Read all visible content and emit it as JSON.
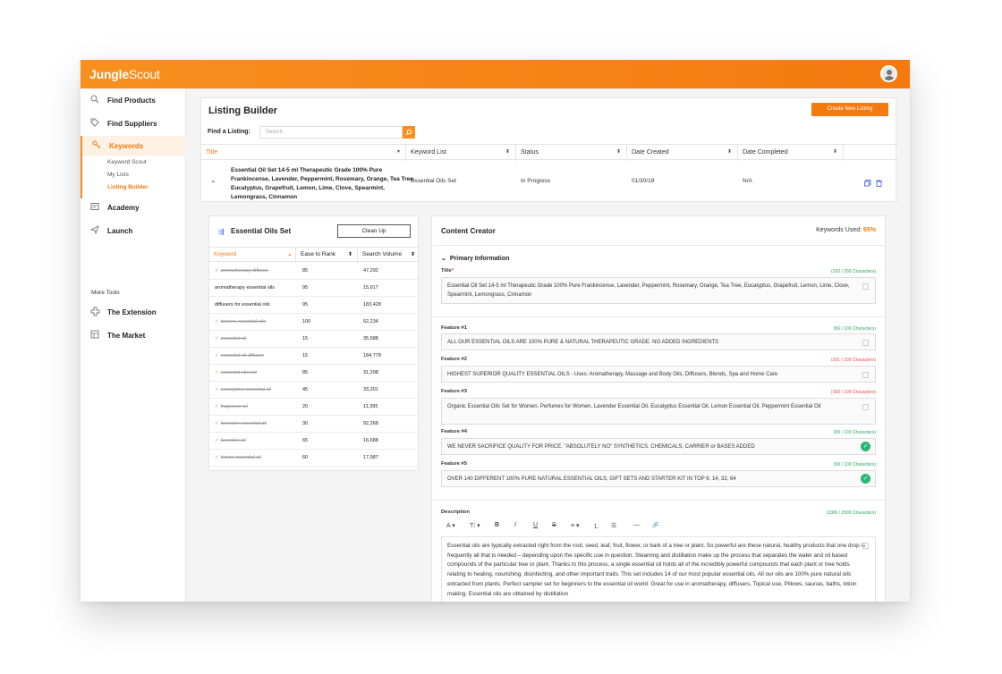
{
  "app": {
    "logo_bold": "Jungle",
    "logo_light": "Scout"
  },
  "sidebar": {
    "items": [
      {
        "label": "Find Products",
        "icon": "search-icon"
      },
      {
        "label": "Find Suppliers",
        "icon": "tag-icon"
      },
      {
        "label": "Keywords",
        "icon": "key-icon",
        "active": true
      },
      {
        "label": "Academy",
        "icon": "academy-icon"
      },
      {
        "label": "Launch",
        "icon": "send-icon"
      }
    ],
    "keywords_sub": [
      "Keyword Scout",
      "My Lists",
      "Listing Builder"
    ],
    "more_tools_label": "More Tools",
    "tools": [
      {
        "label": "The Extension",
        "icon": "extension-icon"
      },
      {
        "label": "The Market",
        "icon": "market-icon"
      }
    ]
  },
  "listing_builder": {
    "title": "Listing Builder",
    "create_button": "Create New Listing",
    "find_label": "Find a Listing:",
    "search_placeholder": "Search",
    "columns": [
      "Title",
      "Keyword List",
      "Status",
      "Date Created",
      "Date Completed"
    ],
    "row": {
      "title": "Essential Oil Set 14-5 ml Therapeutic Grade 100% Pure Frankincense, Lavender, Peppermint, Rosemary, Orange, Tea Tree, Eucalyptus, Grapefruit, Lemon, Lime, Clove, Spearmint, Lemongrass, Cinnamon",
      "keyword_list": "Essential Oils Set",
      "status": "In Progress",
      "date_created": "01/30/19",
      "date_completed": "N/A"
    }
  },
  "keyword_panel": {
    "title": "Essential Oils Set",
    "clean_up_button": "Clean Up",
    "columns": [
      "Keyword",
      "Ease to Rank",
      "Search Volume"
    ],
    "rows": [
      {
        "keyword": "aromatherapy diffuser",
        "ease": "85",
        "volume": "47,292",
        "used": true
      },
      {
        "keyword": "aromatherapy essential oils",
        "ease": "95",
        "volume": "15,917",
        "used": false
      },
      {
        "keyword": "diffusers for essential oils",
        "ease": "95",
        "volume": "183,428",
        "used": false
      },
      {
        "keyword": "doterra essential oils",
        "ease": "100",
        "volume": "52,234",
        "used": true
      },
      {
        "keyword": "essential oil",
        "ease": "15",
        "volume": "35,588",
        "used": true
      },
      {
        "keyword": "essential oil diffuser",
        "ease": "15",
        "volume": "184,778",
        "used": true
      },
      {
        "keyword": "essential oils set",
        "ease": "85",
        "volume": "31,298",
        "used": true
      },
      {
        "keyword": "eucalyptus essential oil",
        "ease": "45",
        "volume": "33,201",
        "used": true
      },
      {
        "keyword": "fragrance oil",
        "ease": "20",
        "volume": "11,395",
        "used": true
      },
      {
        "keyword": "lavender essential oil",
        "ease": "30",
        "volume": "92,268",
        "used": true
      },
      {
        "keyword": "lavender oil",
        "ease": "65",
        "volume": "16,688",
        "used": true
      },
      {
        "keyword": "lemon essential oil",
        "ease": "60",
        "volume": "17,987",
        "used": true
      }
    ]
  },
  "content_creator": {
    "title": "Content Creator",
    "keywords_used_label": "Keywords Used:",
    "keywords_used_value": "65%",
    "primary_section": "Primary Information",
    "title_label": "Title",
    "title_count": "(193 / 200 Characters)",
    "title_value": "Essential Oil Set 14-5 ml Therapeutic Grade 100% Pure Frankincense, Lavender, Peppermint, Rosemary, Orange, Tea Tree, Eucalyptus, Grapefruit, Lemon, Lime, Clove, Spearmint, Lemongrass, Cinnamon",
    "features": [
      {
        "label": "Feature #1",
        "count": "(66 / 100 Characters)",
        "status": "ok",
        "value": "ALL OUR ESSENTIAL OILS ARE 100% PURE & NATURAL THERAPEUTIC GRADE. NO ADDED INGREDIENTS"
      },
      {
        "label": "Feature #2",
        "count": "(101 / 100 Characters)",
        "status": "over",
        "value": "HIGHEST SUPERIOR QUALITY ESSENTIAL OILS - Uses: Aromatherapy, Massage and Body Oils, Diffusers, Blends, Spa and Home Care"
      },
      {
        "label": "Feature #3",
        "count": "(183 / 100 Characters)",
        "status": "over",
        "value": "Organic Essential Oils Set for Women, Perfumes for Women, Lavender Essential Oil, Eucalyptus Essential Oil, Lemon Essential Oil, Peppermint Essential Oil"
      },
      {
        "label": "Feature #4",
        "count": "(99 / 100 Characters)",
        "status": "ok",
        "value": "WE NEVER SACRIFICE QUALITY FOR PRICE. \"ABSOLUTELY NO\" SYNTHETICS, CHEMICALS, CARRIER or BASES ADDED"
      },
      {
        "label": "Feature #5",
        "count": "(99 / 100 Characters)",
        "status": "ok",
        "value": "OVER 140 DIFFERENT 100% PURE NATURAL ESSENTIAL OILS, GIFT SETS AND STARTER KIT IN TOP 6, 14, 32, 64"
      }
    ],
    "description_label": "Description",
    "description_count": "(1006 / 2000 Characters)",
    "toolbar": [
      "A ▾",
      "T⁞ ▾",
      "B",
      "I",
      "U",
      "S",
      "≡ ▾",
      "⒈",
      "☰",
      "—",
      "🔗"
    ],
    "description_value": "Essential oils are typically extracted right from the root, seed, leaf, fruit, flower, or bark of a tree or plant. So powerful are these natural, healthy products that one drop is frequently all that is needed – depending upon the specific use in question. Steaming and distillation make up the process that separates the water and oil based compounds of the particular tree or plant. Thanks to this process, a single essential oil holds all of the incredibly powerful compounds that each plant or tree holds relating to healing, nourishing, disinfecting, and other important traits. This set includes 14 of our most popular essential oils. All our oils are 100% pure natural oils extracted from plants. Perfect sampler set for beginners to the essential oil world. Great for use in aromatherapy, diffusers, Topical use, Pillows, saunas, baths, lotion making. Essential oils are obtained by distillation"
  },
  "colors": {
    "brand_orange": "#f47a0e",
    "ok_green": "#2aa55a",
    "over_red": "#e44"
  }
}
